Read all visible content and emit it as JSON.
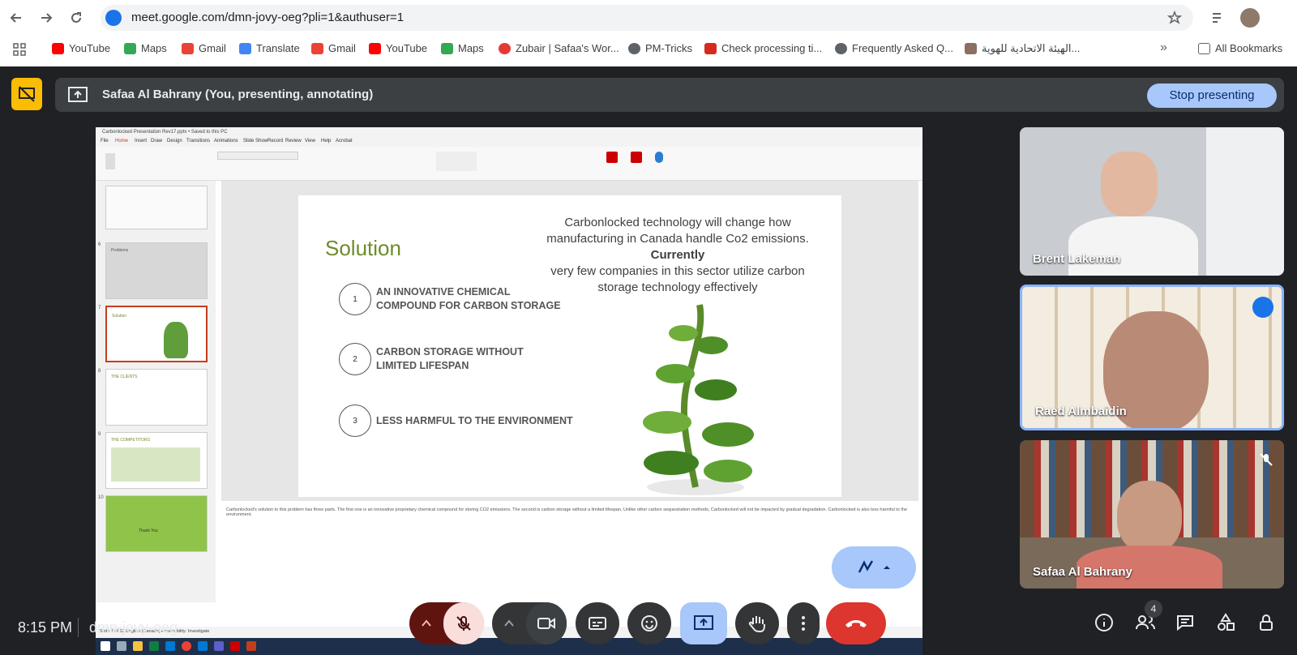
{
  "browser": {
    "url": "meet.google.com/dmn-jovy-oeg?pli=1&authuser=1",
    "bookmarks": [
      {
        "label": "YouTube",
        "color": "#ff0000"
      },
      {
        "label": "Maps",
        "color": "#34a853"
      },
      {
        "label": "Gmail",
        "color": "#ea4335"
      },
      {
        "label": "Translate",
        "color": "#4285f4"
      },
      {
        "label": "Gmail",
        "color": "#ea4335"
      },
      {
        "label": "YouTube",
        "color": "#ff0000"
      },
      {
        "label": "Maps",
        "color": "#34a853"
      },
      {
        "label": "Zubair | Safaa's Wor...",
        "color": "#e53935"
      },
      {
        "label": "PM-Tricks",
        "color": "#5f6368"
      },
      {
        "label": "Check processing ti...",
        "color": "#d52b1e"
      },
      {
        "label": "Frequently Asked Q...",
        "color": "#5f6368"
      },
      {
        "label": "الهيئة الاتحادية للهوية...",
        "color": "#8d6e63"
      }
    ],
    "all_bookmarks": "All Bookmarks"
  },
  "banner": {
    "presenting_text": "Safaa Al Bahrany (You, presenting, annotating)",
    "stop_label": "Stop presenting"
  },
  "powerpoint": {
    "title": "Carbonlocked Presentation Rev17.pptx • Saved to this PC",
    "menu": [
      "File",
      "Home",
      "Insert",
      "Draw",
      "Design",
      "Transitions",
      "Animations",
      "Slide Show",
      "Record",
      "Review",
      "View",
      "Help",
      "Acrobat"
    ],
    "thumb_numbers": [
      "6",
      "7",
      "8",
      "9",
      "10"
    ],
    "thumb_labels": [
      "Problems",
      "Solution",
      "THE CLIENTS",
      "THE COMPETITORS",
      "Thank You"
    ],
    "status_text": "Slide 7 of 12   English (Canada)   Accessibility: Investigate",
    "notes": "Carbonlocked's solution to this problem has three parts. The first one is an innovative proprietary chemical compound for storing CO2 emissions. The second is carbon storage without a limited lifespan. Unlike other carbon sequestration methods, Carbonlocked will not be impacted by gradual degradation. Carbonlocked is also less harmful to the environment.",
    "slide": {
      "title": "Solution",
      "desc_line1": "Carbonlocked technology will change how manufacturing in Canada handle Co2 emissions.",
      "desc_bold": "Currently",
      "desc_line2": "very few companies in this sector utilize carbon storage technology effectively",
      "items": [
        {
          "num": "1",
          "text": "AN INNOVATIVE CHEMICAL COMPOUND FOR CARBON STORAGE"
        },
        {
          "num": "2",
          "text": "CARBON STORAGE WITHOUT LIMITED LIFESPAN"
        },
        {
          "num": "3",
          "text": "LESS HARMFUL TO THE ENVIRONMENT"
        }
      ]
    }
  },
  "participants": [
    {
      "name": "Brent Lakeman"
    },
    {
      "name": "Raed Almbaidin"
    },
    {
      "name": "Safaa Al Bahrany"
    }
  ],
  "footer": {
    "time": "8:15 PM",
    "meeting_code": "dmn-jovy-oeg",
    "people_count": "4"
  }
}
